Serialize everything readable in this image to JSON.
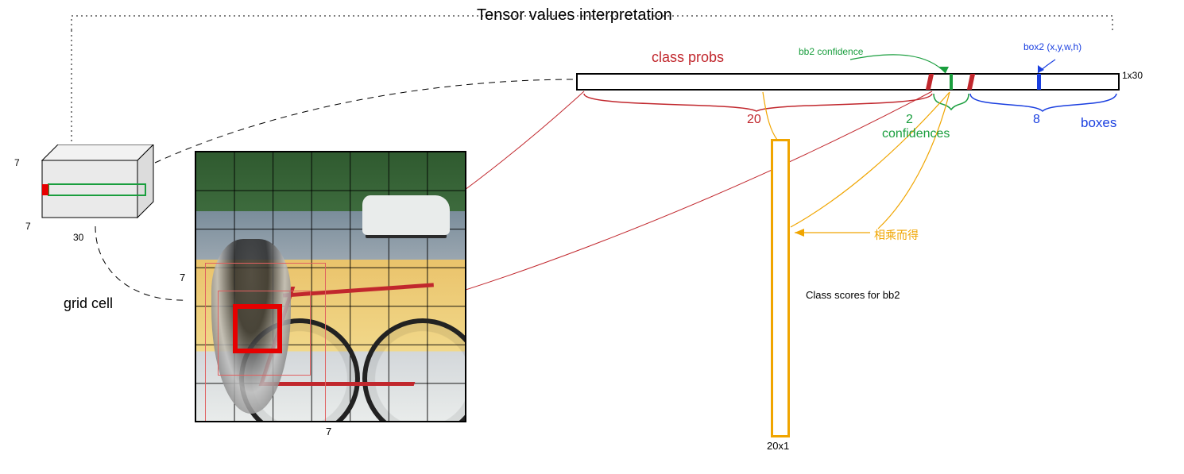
{
  "title": "Tensor values interpretation",
  "tensor_cube": {
    "dim_h": "7",
    "dim_w": "7",
    "dim_d": "30",
    "grid_cell_label": "grid cell"
  },
  "image_panel": {
    "axis_h": "7",
    "axis_w": "7"
  },
  "tensor_bar": {
    "size_label": "1x30",
    "class_probs": {
      "label": "class probs",
      "count": "20",
      "color": "#c1272d"
    },
    "confidences": {
      "label": "confidences",
      "count": "2",
      "bb2_hint": "bb2 confidence",
      "color": "#1a9e3e"
    },
    "boxes": {
      "label": "boxes",
      "count": "8",
      "box2_hint": "box2 (x,y,w,h)",
      "color": "#1a3fe0"
    }
  },
  "score_vector": {
    "caption": "Class scores for bb2",
    "size": "20x1",
    "mult_note": "相乘而得"
  }
}
